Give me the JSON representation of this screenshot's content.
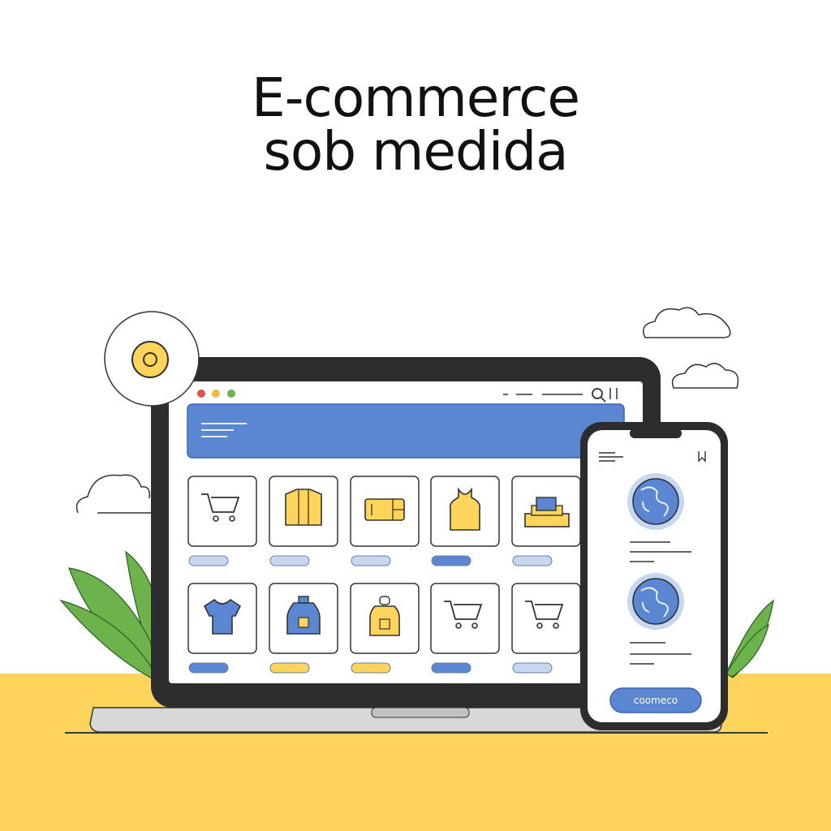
{
  "headline": {
    "line1": "E-commerce",
    "line2": "sob medida"
  },
  "colors": {
    "accent_blue": "#5b86d2",
    "accent_yellow": "#ffd45a",
    "leaf_green": "#6bb34a",
    "frame_dark": "#2d2d2d",
    "pill_light": "#c7d7f0"
  },
  "laptop": {
    "window_buttons": [
      "red-dot",
      "yellow-dot",
      "green-dot"
    ],
    "toolbar_icons": [
      "search-icon",
      "bookmark-icon"
    ],
    "product_rows": [
      [
        {
          "icon": "cart-icon",
          "tag": "light"
        },
        {
          "icon": "shirt-yellow-icon",
          "tag": "light"
        },
        {
          "icon": "card-icon",
          "tag": "light"
        },
        {
          "icon": "tank-top-icon",
          "tag": "blue"
        },
        {
          "icon": "box-icon",
          "tag": "light"
        }
      ],
      [
        {
          "icon": "shirt-blue-icon",
          "tag": "blue"
        },
        {
          "icon": "bottle-blue-icon",
          "tag": "yellow"
        },
        {
          "icon": "bottle-yellow-icon",
          "tag": "yellow"
        },
        {
          "icon": "cart-icon",
          "tag": "blue"
        },
        {
          "icon": "cart-icon",
          "tag": "light"
        }
      ]
    ]
  },
  "phone": {
    "icons": [
      "menu-icon",
      "bookmark-icon",
      "globe-icon",
      "globe-icon"
    ],
    "button_label": "coomeco"
  }
}
